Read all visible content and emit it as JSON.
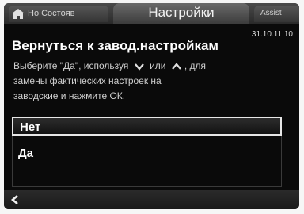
{
  "header": {
    "home_tab_label": "Но Состояв",
    "title": "Настройки",
    "right_tab_label": "Assist",
    "datetime": "31.10.11 10"
  },
  "content": {
    "heading": "Вернуться к завод.настройкам",
    "instruction_line1_part1": "Выберите \"Да\", используя",
    "instruction_line1_part2": "или",
    "instruction_line1_part3": ", для",
    "instruction_line2": "замены фактических настроек на",
    "instruction_line3": "заводские и нажмите ОК."
  },
  "options": [
    {
      "label": "Нет",
      "selected": true
    },
    {
      "label": "Да",
      "selected": false
    }
  ],
  "icons": {
    "home": "home-icon",
    "down": "chevron-down-icon",
    "up": "chevron-up-icon",
    "back": "back-arrow-icon"
  },
  "colors": {
    "screen_bg": "#0a0a0a",
    "text": "#ffffff",
    "selection_border": "#e6e6e6"
  }
}
